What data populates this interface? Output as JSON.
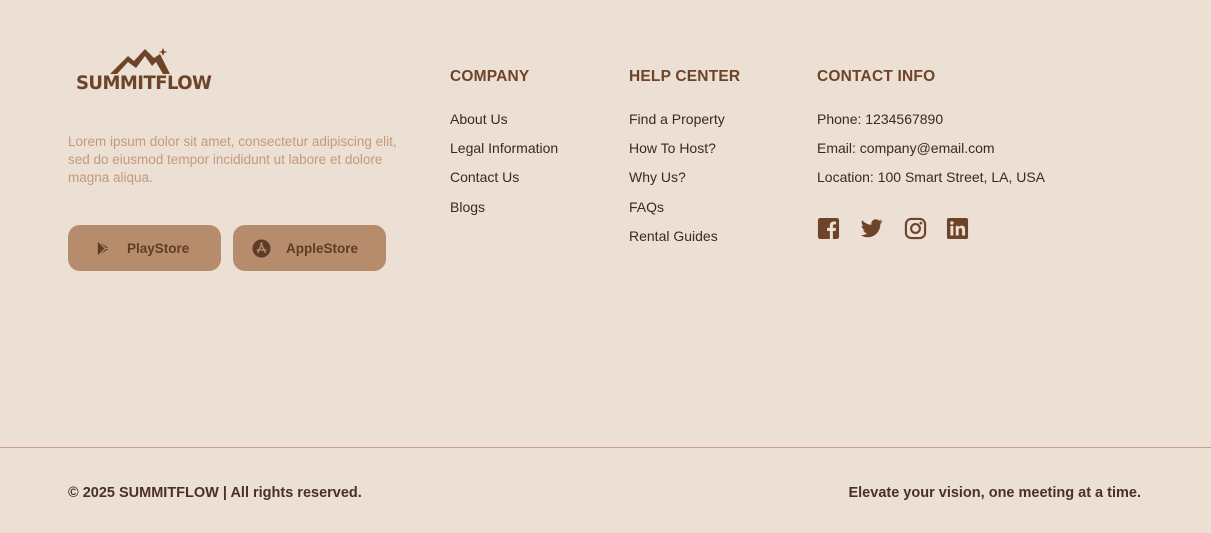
{
  "brand": {
    "name": "SUMMITFLOW",
    "description": "Lorem ipsum dolor sit amet, consectetur adipiscing elit, sed do eiusmod tempor incididunt ut labore et dolore magna aliqua.",
    "accent_color": "#6e4428",
    "button_color": "#b78c6c",
    "background_color": "#ecdfd4"
  },
  "store_buttons": {
    "play": {
      "label": "PlayStore",
      "icon": "play-store-icon"
    },
    "apple": {
      "label": "AppleStore",
      "icon": "app-store-icon"
    }
  },
  "company": {
    "heading": "COMPANY",
    "links": [
      "About Us",
      "Legal Information",
      "Contact Us",
      "Blogs"
    ]
  },
  "help_center": {
    "heading": "HELP CENTER",
    "links": [
      "Find a Property",
      "How To Host?",
      "Why Us?",
      "FAQs",
      "Rental Guides"
    ]
  },
  "contact": {
    "heading": "CONTACT INFO",
    "phone": "Phone: 1234567890",
    "email": "Email: company@email.com",
    "location": "Location: 100 Smart Street, LA, USA"
  },
  "socials": [
    "facebook-icon",
    "twitter-icon",
    "instagram-icon",
    "linkedin-icon"
  ],
  "footer": {
    "copyright": "© 2025 SUMMITFLOW | All rights reserved.",
    "tagline": "Elevate your vision, one meeting at a time."
  }
}
